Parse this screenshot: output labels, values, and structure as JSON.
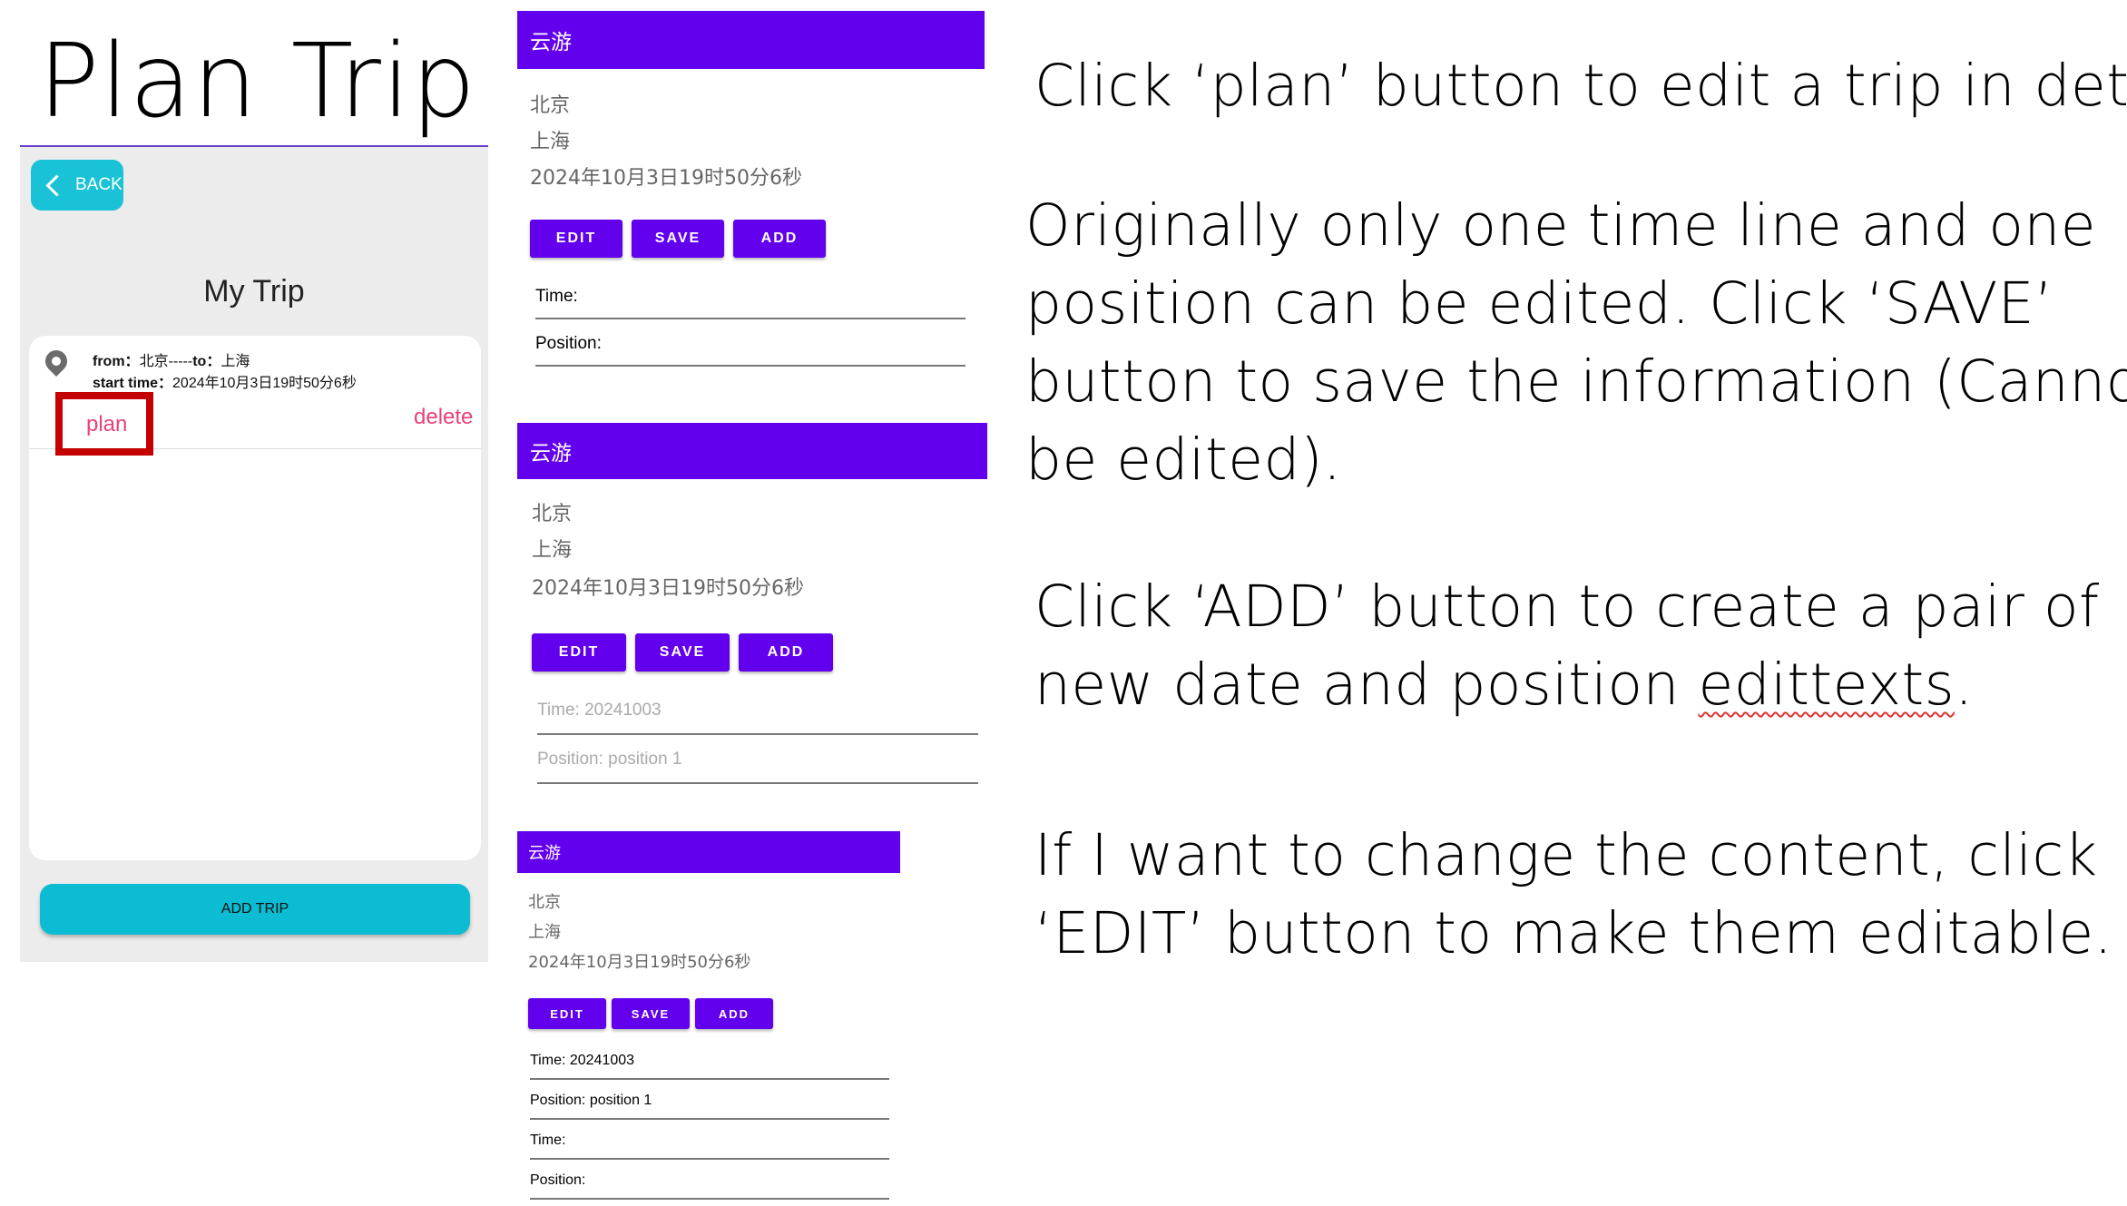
{
  "plan_trip": {
    "title": "Plan Trip",
    "back_label": "BACK",
    "heading": "My Trip",
    "trip": {
      "from_label": "from：",
      "from_value": "北京-----",
      "to_label": "to：",
      "to_value": "上海",
      "start_label": "start time：",
      "start_value": "2024年10月3日19时50分6秒",
      "plan_label": "plan",
      "delete_label": "delete"
    },
    "add_trip_label": "ADD TRIP",
    "icons": {
      "back": "chevron-left-icon",
      "location": "location-pin-icon"
    },
    "colors": {
      "accent": "#19c2d6",
      "highlight": "#c40000",
      "link": "#e8417a"
    }
  },
  "panels": [
    {
      "app_title": "云游",
      "from": "北京",
      "to": "上海",
      "start_time": "2024年10月3日19时50分6秒",
      "buttons": {
        "edit": "EDIT",
        "save": "SAVE",
        "add": "ADD"
      },
      "fields": [
        {
          "text": "Time:",
          "hint": false
        },
        {
          "text": "Position:",
          "hint": false
        }
      ]
    },
    {
      "app_title": "云游",
      "from": "北京",
      "to": "上海",
      "start_time": "2024年10月3日19时50分6秒",
      "buttons": {
        "edit": "EDIT",
        "save": "SAVE",
        "add": "ADD"
      },
      "fields": [
        {
          "text": "Time: 20241003",
          "hint": true
        },
        {
          "text": "Position: position 1",
          "hint": true
        }
      ]
    },
    {
      "app_title": "云游",
      "from": "北京",
      "to": "上海",
      "start_time": "2024年10月3日19时50分6秒",
      "buttons": {
        "edit": "EDIT",
        "save": "SAVE",
        "add": "ADD"
      },
      "fields": [
        {
          "text": "Time: 20241003",
          "hint": false
        },
        {
          "text": "Position: position 1",
          "hint": false
        },
        {
          "text": "Time:",
          "hint": false
        },
        {
          "text": "Position:",
          "hint": false
        }
      ]
    }
  ],
  "descriptions": {
    "plan": [
      "Click ‘plan’ button to edit a trip in detail"
    ],
    "save": [
      "Originally only one time line and one",
      "position can be edited. Click ‘SAVE’",
      "button to save the information (Cannot",
      "be edited)."
    ],
    "add_line1": "Click ‘ADD’ button to create a pair of",
    "add_line2_pre": "new date and position ",
    "add_line2_word": "edittexts",
    "add_line2_post": ".",
    "edit": [
      "If I want to change the content, click",
      "‘EDIT’ button to make them editable."
    ]
  },
  "theme": {
    "primary": "#6200ee"
  }
}
